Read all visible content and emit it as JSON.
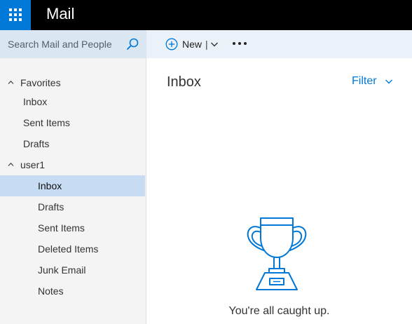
{
  "app": {
    "title": "Mail",
    "launcher_icon": "app-launcher-waffle-icon"
  },
  "search": {
    "placeholder": "Search Mail and People",
    "icon": "search-icon"
  },
  "toolbar": {
    "new_label": "New",
    "new_separator": "|",
    "more_icon": "ellipsis-icon"
  },
  "sidebar": {
    "favorites": {
      "label": "Favorites",
      "items": [
        {
          "label": "Inbox"
        },
        {
          "label": "Sent Items"
        },
        {
          "label": "Drafts"
        }
      ]
    },
    "account": {
      "label": "user1",
      "items": [
        {
          "label": "Inbox",
          "selected": true
        },
        {
          "label": "Drafts"
        },
        {
          "label": "Sent Items"
        },
        {
          "label": "Deleted Items"
        },
        {
          "label": "Junk Email"
        },
        {
          "label": "Notes"
        }
      ]
    }
  },
  "main": {
    "folder_title": "Inbox",
    "filter_label": "Filter",
    "empty_state_text": "You're all caught up.",
    "empty_state_icon": "trophy-icon"
  },
  "colors": {
    "accent": "#0078d7",
    "topbar": "#000000",
    "search_bg": "#dbe6f3",
    "commandbar_bg": "#eaf1f9",
    "sidebar_bg": "#f4f4f4",
    "selected_bg": "#c7dcf2"
  }
}
